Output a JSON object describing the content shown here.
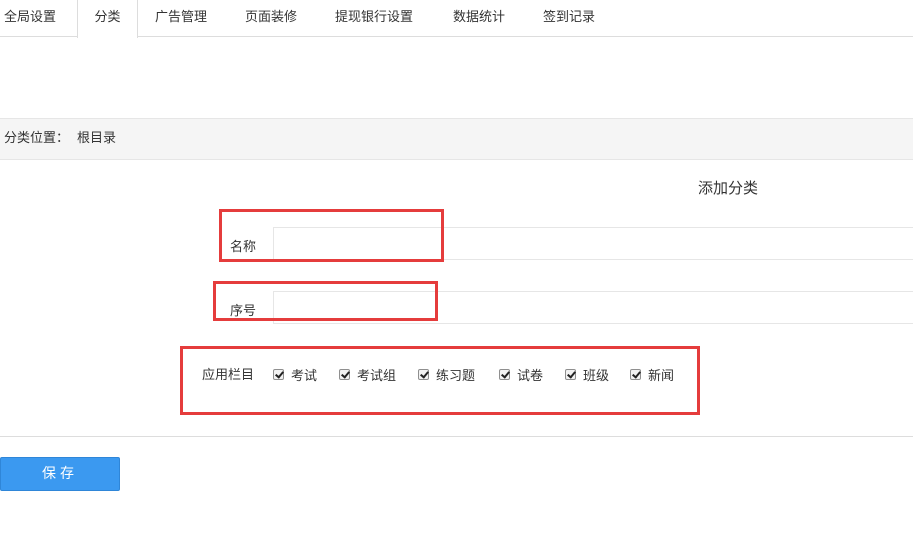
{
  "tabs": [
    {
      "label": "全局设置",
      "active": false
    },
    {
      "label": "分类",
      "active": true
    },
    {
      "label": "广告管理",
      "active": false
    },
    {
      "label": "页面装修",
      "active": false
    },
    {
      "label": "提现银行设置",
      "active": false
    },
    {
      "label": "数据统计",
      "active": false
    },
    {
      "label": "签到记录",
      "active": false
    }
  ],
  "location": {
    "label": "分类位置：",
    "value": "根目录"
  },
  "form": {
    "title": "添加分类",
    "name_label": "名称",
    "name_value": "",
    "order_label": "序号",
    "order_value": "",
    "columns_label": "应用栏目",
    "columns": [
      {
        "label": "考试",
        "checked": true
      },
      {
        "label": "考试组",
        "checked": true
      },
      {
        "label": "练习题",
        "checked": true
      },
      {
        "label": "试卷",
        "checked": true
      },
      {
        "label": "班级",
        "checked": true
      },
      {
        "label": "新闻",
        "checked": true
      }
    ]
  },
  "save_label": "保存",
  "colors": {
    "accent": "#3b99f0",
    "highlight": "#e53c3c",
    "bar_background": "#f5f5f5"
  }
}
